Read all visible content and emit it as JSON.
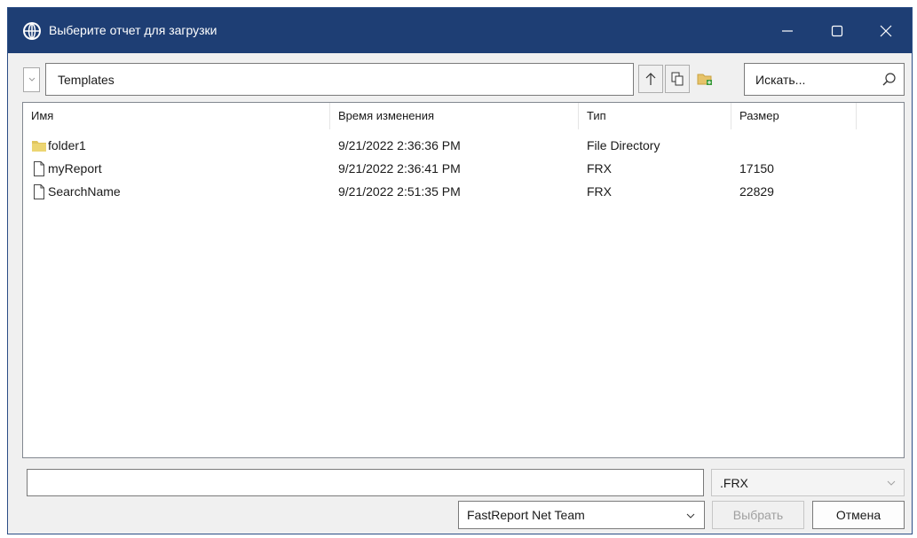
{
  "window": {
    "title": "Выберите отчет для загрузки",
    "accent_color": "#1e3e74"
  },
  "title_controls": {
    "minimize_icon": "minimize-icon",
    "maximize_icon": "maximize-icon",
    "close_icon": "close-icon"
  },
  "toolbar": {
    "current_path": "Templates",
    "up_icon": "arrow-up-icon",
    "copy_icon": "copy-icon",
    "new_folder_icon": "new-folder-icon",
    "search_placeholder": "Искать..."
  },
  "list": {
    "columns": [
      "Имя",
      "Время изменения",
      "Тип",
      "Размер"
    ],
    "rows": [
      {
        "icon": "folder-icon",
        "name": "folder1",
        "modified": "9/21/2022 2:36:36 PM",
        "type": "File Directory",
        "size": ""
      },
      {
        "icon": "file-icon",
        "name": "myReport",
        "modified": "9/21/2022 2:36:41 PM",
        "type": "FRX",
        "size": "17150"
      },
      {
        "icon": "file-icon",
        "name": "SearchName",
        "modified": "9/21/2022 2:51:35 PM",
        "type": "FRX",
        "size": "22829"
      }
    ]
  },
  "footer": {
    "filename_value": "",
    "filter_value": ".FRX",
    "account_value": "FastReport Net Team",
    "select_label": "Выбрать",
    "cancel_label": "Отмена"
  }
}
